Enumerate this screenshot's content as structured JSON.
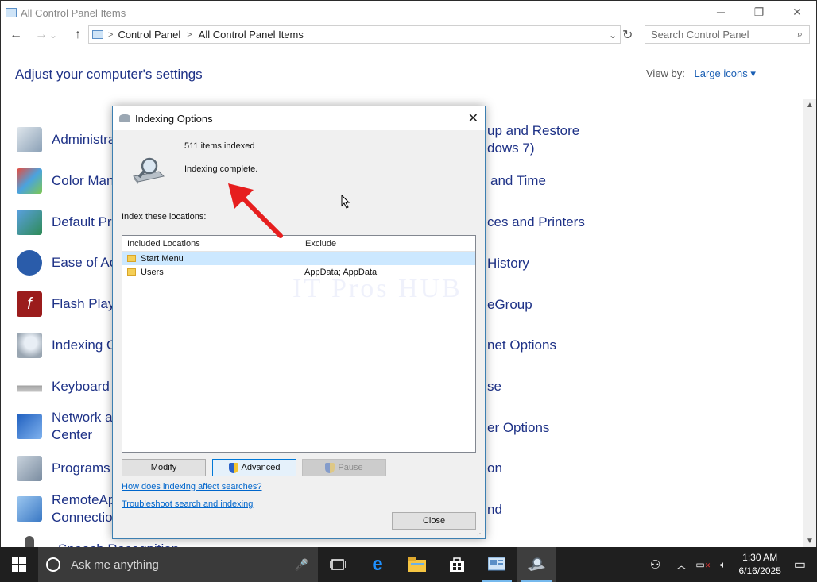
{
  "window": {
    "title": "All Control Panel Items",
    "controls": {
      "minimize": "─",
      "restore": "❐",
      "close": "✕"
    }
  },
  "nav": {
    "back": "←",
    "forward": "→",
    "down": "⌄",
    "up": "↑",
    "breadcrumb": [
      "Control Panel",
      "All Control Panel Items"
    ],
    "breadcrumb_sep": ">",
    "dropdown": "⌄",
    "refresh": "↻",
    "search_placeholder": "Search Control Panel"
  },
  "header": {
    "title": "Adjust your computer's settings",
    "view_by_label": "View by:",
    "view_by_value": "Large icons ▾"
  },
  "items_left": [
    {
      "label": "Administra",
      "color": "#8aa0b6"
    },
    {
      "label": "Color Mana",
      "color": "#4aa3df"
    },
    {
      "label": "Default Pro",
      "color": "#2e8b57"
    },
    {
      "label": "Ease of Acc",
      "color": "#2a5caa"
    },
    {
      "label": "Flash Playe",
      "color": "#9b1c1c"
    },
    {
      "label": "Indexing O",
      "color": "#9aa6b2"
    },
    {
      "label": "Keyboard",
      "color": "#a0a0a0"
    },
    {
      "label": "Network ar",
      "label2": "Center",
      "color": "#1f5fbf"
    },
    {
      "label": "Programs a",
      "color": "#7a8ca0"
    },
    {
      "label": "RemoteAp",
      "label2": "Connection",
      "color": "#3a78c4"
    },
    {
      "label": "Speech Recognition",
      "color": "#555555"
    }
  ],
  "items_right": [
    {
      "label": "up and Restore",
      "label2": "dows 7)"
    },
    {
      "label": "and Time"
    },
    {
      "label": "ces and Printers"
    },
    {
      "label": "History"
    },
    {
      "label": "eGroup"
    },
    {
      "label": "net Options"
    },
    {
      "label": "se"
    },
    {
      "label": "er Options"
    },
    {
      "label": "on"
    },
    {
      "label": "nd"
    }
  ],
  "dialog": {
    "title": "Indexing Options",
    "close": "✕",
    "items_indexed": "511 items indexed",
    "status": "Indexing complete.",
    "index_label": "Index these locations:",
    "columns": [
      "Included Locations",
      "Exclude"
    ],
    "rows": [
      {
        "location": "Start Menu",
        "exclude": ""
      },
      {
        "location": "Users",
        "exclude": "AppData; AppData"
      }
    ],
    "buttons": {
      "modify": "Modify",
      "advanced": "Advanced",
      "pause": "Pause",
      "close": "Close"
    },
    "links": [
      "How does indexing affect searches?",
      "Troubleshoot search and indexing"
    ]
  },
  "watermark": "IT Pros HUB",
  "taskbar": {
    "search_placeholder": "Ask me anything",
    "time": "1:30 AM",
    "date": "6/16/2025"
  }
}
